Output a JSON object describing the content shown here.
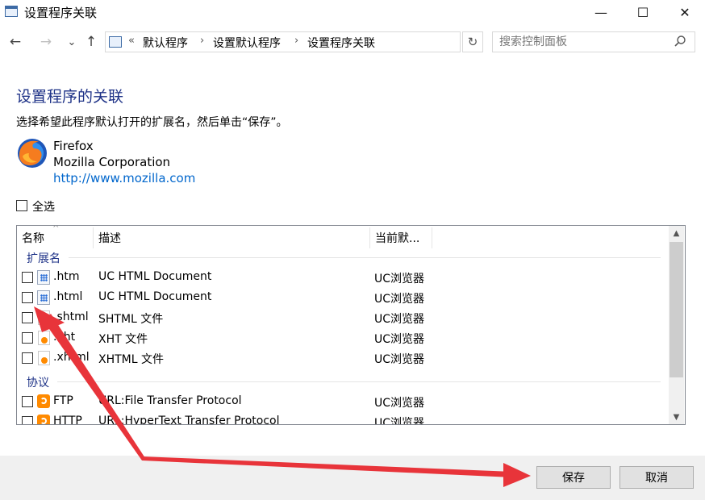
{
  "window": {
    "title": "设置程序关联",
    "controls": {
      "minimize": "—",
      "maximize": "☐",
      "close": "✕"
    }
  },
  "nav": {
    "back": "←",
    "forward": "→",
    "recent": "⌄",
    "up": "↑",
    "breadcrumb_prefix": "«",
    "breadcrumbs": [
      "默认程序",
      "设置默认程序",
      "设置程序关联"
    ],
    "crumb_separator": "›",
    "refresh": "↻",
    "search_placeholder": "搜索控制面板"
  },
  "content": {
    "title": "设置程序的关联",
    "instruction": "选择希望此程序默认打开的扩展名，然后单击“保存”。",
    "program": {
      "name": "Firefox",
      "company": "Mozilla Corporation",
      "url": "http://www.mozilla.com"
    },
    "select_all_label": "全选"
  },
  "list": {
    "columns": [
      "名称",
      "描述",
      "当前默..."
    ],
    "groups": [
      {
        "label": "扩展名",
        "rows": [
          {
            "name": ".htm",
            "description": "UC HTML Document",
            "current": "UC浏览器",
            "icon": "html-file-icon"
          },
          {
            "name": ".html",
            "description": "UC HTML Document",
            "current": "UC浏览器",
            "icon": "html-file-icon"
          },
          {
            "name": ".shtml",
            "description": "SHTML 文件",
            "current": "UC浏览器",
            "icon": "uc-document-icon"
          },
          {
            "name": ".xht",
            "description": "XHT 文件",
            "current": "UC浏览器",
            "icon": "uc-document-icon"
          },
          {
            "name": ".xhtml",
            "description": "XHTML 文件",
            "current": "UC浏览器",
            "icon": "uc-document-icon"
          }
        ]
      },
      {
        "label": "协议",
        "rows": [
          {
            "name": "FTP",
            "description": "URL:File Transfer Protocol",
            "current": "UC浏览器",
            "icon": "uc-browser-icon"
          },
          {
            "name": "HTTP",
            "description": "URL:HyperText Transfer Protocol",
            "current": "UC浏览器",
            "icon": "uc-browser-icon"
          }
        ]
      }
    ]
  },
  "footer": {
    "save_label": "保存",
    "cancel_label": "取消"
  },
  "colors": {
    "heading": "#1e3287",
    "link": "#0066cc",
    "annotation_arrow": "#e8343a",
    "footer_bg": "#f0f0f0"
  }
}
